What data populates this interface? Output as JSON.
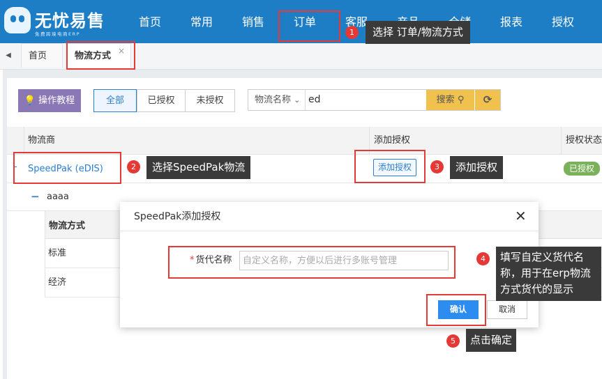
{
  "app": {
    "name": "无忧易售",
    "subtitle": "免费跨境电商ERP"
  },
  "nav": {
    "items": [
      "首页",
      "常用",
      "销售",
      "订单",
      "客服",
      "产品",
      "仓储",
      "报表",
      "授权"
    ]
  },
  "tabs": {
    "items": [
      {
        "label": "首页"
      },
      {
        "label": "物流方式",
        "close": "×"
      }
    ]
  },
  "toolbar": {
    "tutorial_label": "操作教程",
    "filter_all": "全部",
    "filter_authorized": "已授权",
    "filter_unauthorized": "未授权",
    "search_field": "物流名称",
    "search_value": "ed",
    "search_button": "搜索",
    "refresh_icon": "refresh-icon"
  },
  "table": {
    "headers": [
      "物流商",
      "添加授权",
      "授权状态"
    ],
    "row": {
      "provider": "SpeedPak (eDIS)",
      "action": "添加授权",
      "status": "已授权"
    },
    "sub_account": "aaaa",
    "sub_header": "物流方式",
    "sub_rows": [
      "标准",
      "经济"
    ]
  },
  "modal": {
    "title": "SpeedPak添加授权",
    "field_label": "货代名称",
    "field_placeholder": "自定义名称，方便以后进行多账号管理",
    "field_value": "",
    "confirm_label": "确认",
    "cancel_label": "取消"
  },
  "annotations": [
    {
      "num": "1",
      "text": "选择 订单/物流方式"
    },
    {
      "num": "2",
      "text": "选择SpeedPak物流"
    },
    {
      "num": "3",
      "text": "添加授权"
    },
    {
      "num": "4",
      "lines": [
        "填写自定义货代名",
        "称，用于在erp物流",
        "方式货代的显示"
      ]
    },
    {
      "num": "5",
      "text": "点击确定"
    }
  ],
  "colors": {
    "header_blue": "#1d7ec6",
    "link_blue": "#2d7ed0",
    "annotation_red": "#e53935",
    "search_yellow": "#f0c24d",
    "status_green": "#7ab15b",
    "tutorial_purple": "#8a77b5"
  }
}
